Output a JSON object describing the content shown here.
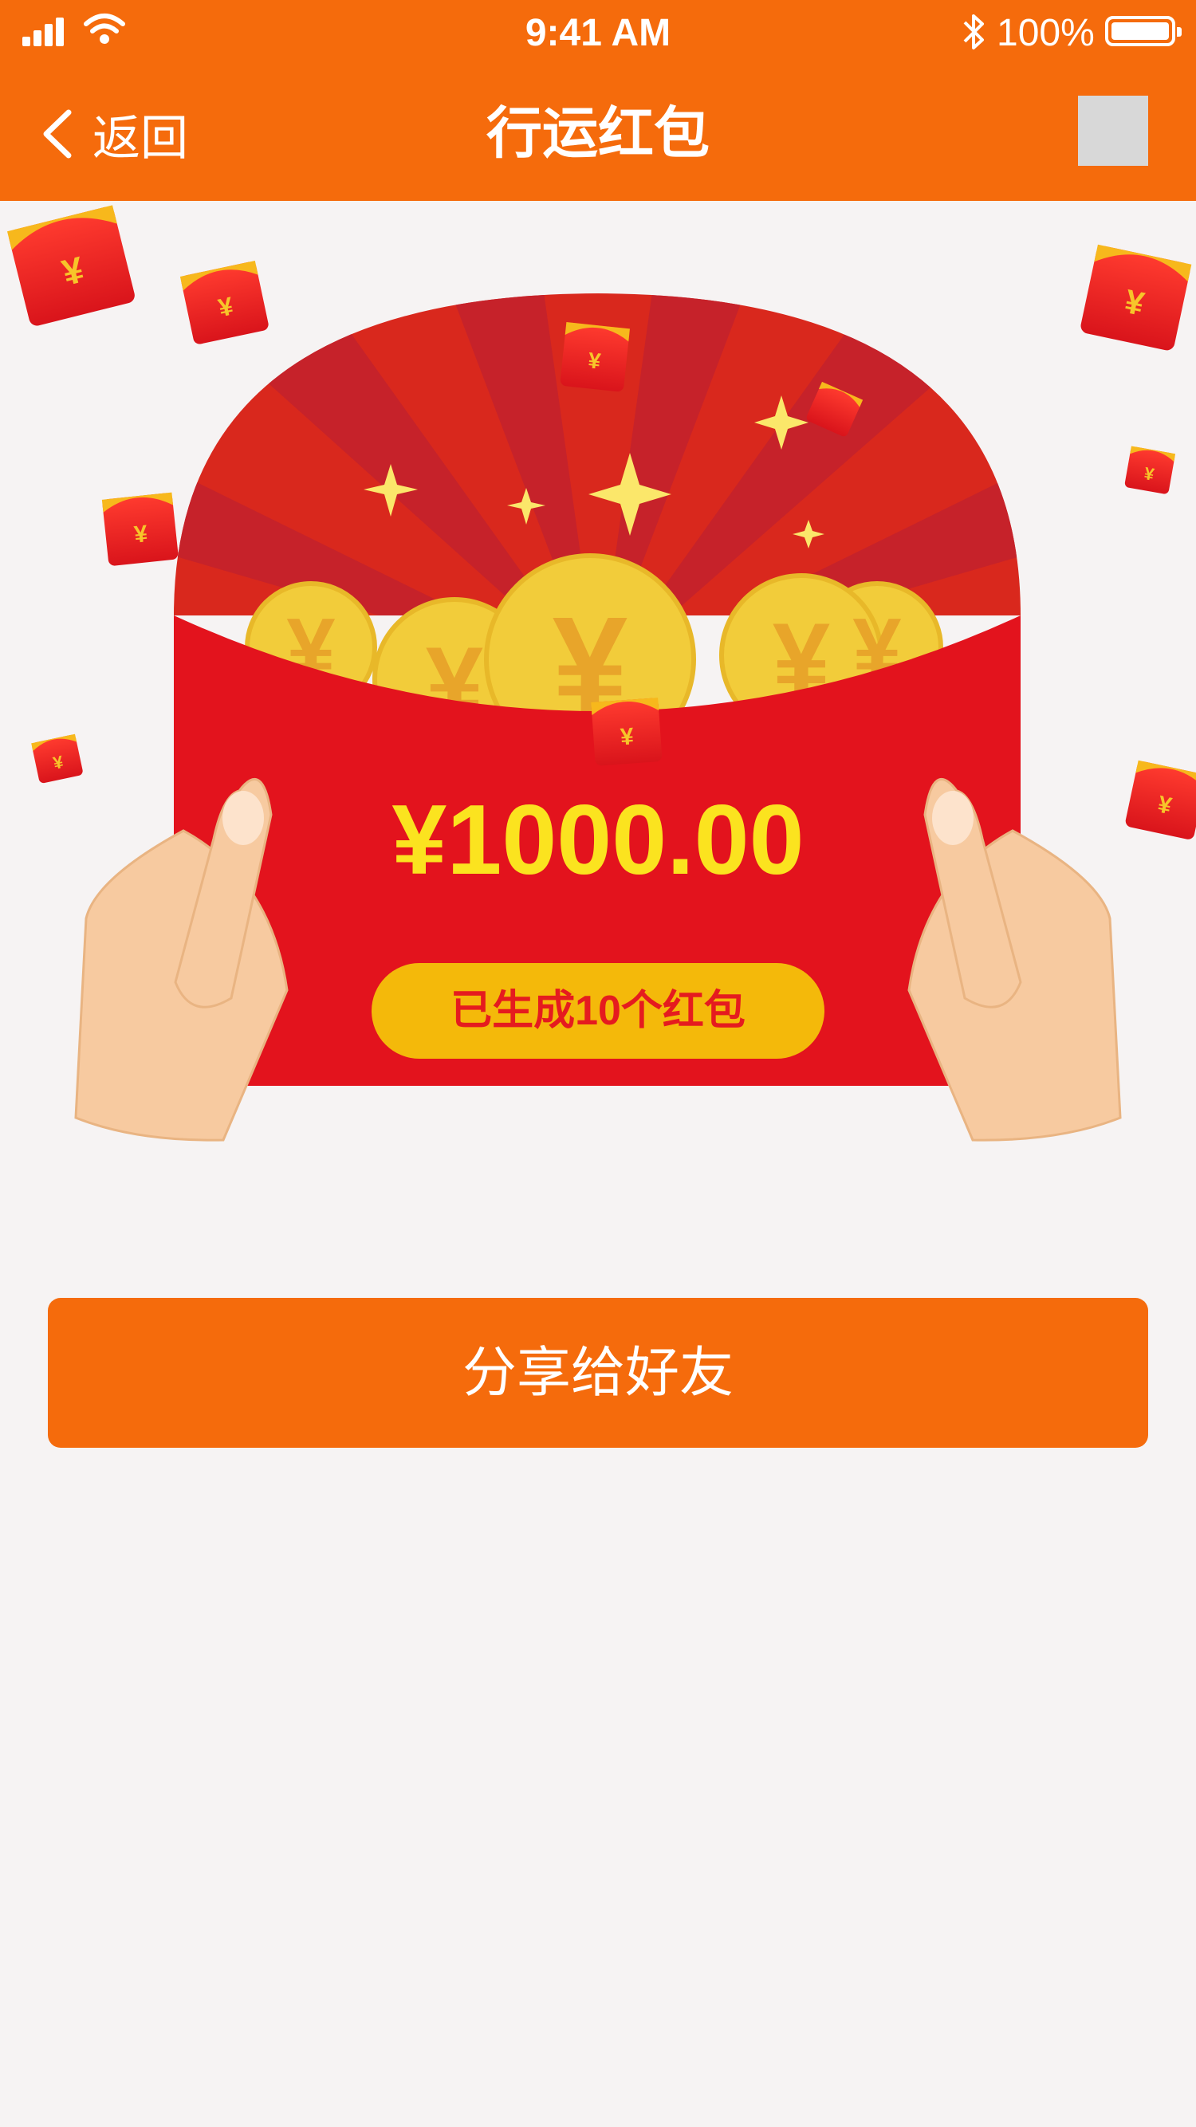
{
  "status_bar": {
    "time": "9:41 AM",
    "battery_pct": "100%"
  },
  "nav": {
    "back_label": "返回",
    "title": "行运红包"
  },
  "envelope": {
    "amount": "¥1000.00",
    "generated_label": "已生成10个红包",
    "coin_symbol": "¥"
  },
  "share_button": {
    "label": "分享给好友"
  },
  "colors": {
    "brand_orange": "#f56b0c",
    "envelope_red": "#e3131d",
    "gold": "#f4b90a",
    "amount_yellow": "#fbe31f",
    "background": "#f6f3f3"
  }
}
